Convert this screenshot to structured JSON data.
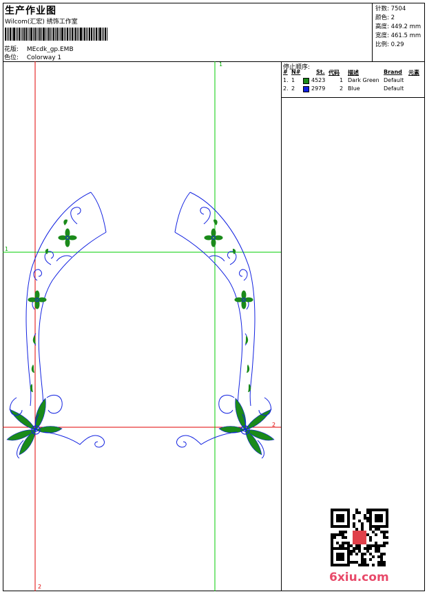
{
  "header": {
    "title": "生产作业图",
    "company": "Wilcom(汇宏) 绣饰工作室",
    "design_label": "花版:",
    "design_value": "MEcdk_gp.EMB",
    "colorway_label": "色位:",
    "colorway_value": "Colorway 1"
  },
  "stats": [
    {
      "label": "针数",
      "value": "7504"
    },
    {
      "label": "颜色",
      "value": "2"
    },
    {
      "label": "高度",
      "value": "449.2 mm"
    },
    {
      "label": "宽度",
      "value": "461.5 mm"
    },
    {
      "label": "比例",
      "value": "0.29"
    }
  ],
  "stop_sequence": {
    "title": "停止顺序:",
    "columns": [
      "#",
      "N#",
      "St.",
      "代码",
      "描述",
      "Brand",
      "元素"
    ],
    "rows": [
      {
        "num": "1.",
        "n": "1",
        "swatch": "#1a8a1a",
        "stitches": "4523",
        "code": "1",
        "desc": "Dark Green",
        "brand": "Default"
      },
      {
        "num": "2.",
        "n": "2",
        "swatch": "#1020e0",
        "stitches": "2979",
        "code": "2",
        "desc": "Blue",
        "brand": "Default"
      }
    ]
  },
  "axes": {
    "h1": "1",
    "v1": "1",
    "h2": "2",
    "v2": "2"
  },
  "watermark": "6xiu.com",
  "colors": {
    "green": "#1a8a1a",
    "blue": "#1020e0",
    "red_guide": "#e00000",
    "green_guide": "#00cc00",
    "watermark": "#e84a6a"
  }
}
